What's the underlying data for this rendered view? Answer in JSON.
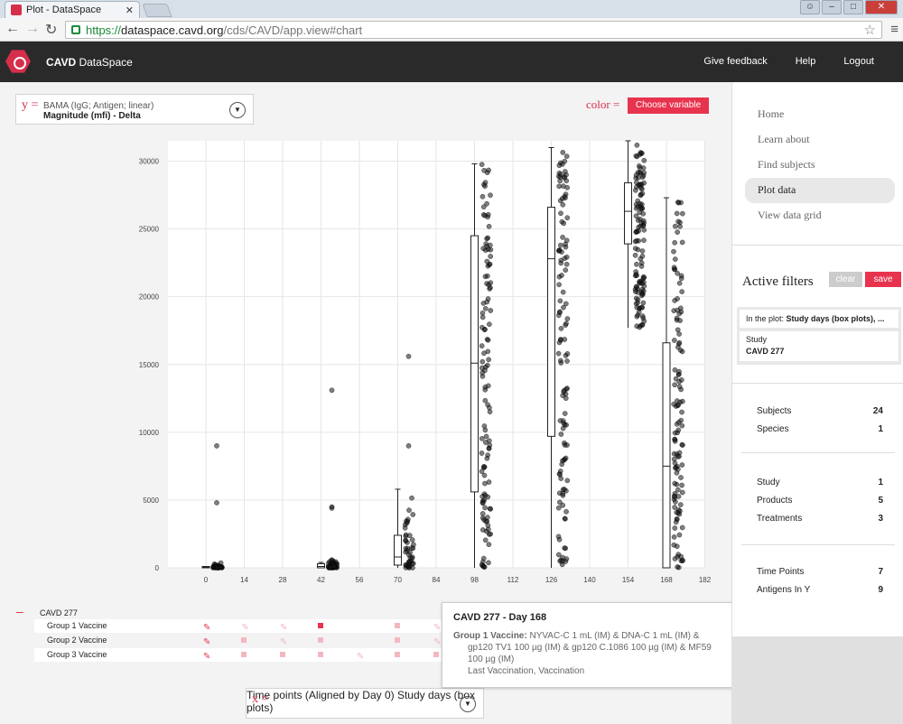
{
  "browser": {
    "tab_title": "Plot - DataSpace",
    "url_scheme": "https://",
    "url_host": "dataspace.cavd.org",
    "url_path": "/cds/CAVD/app.view#chart"
  },
  "app": {
    "name_bold": "CAVD",
    "name_rest": " DataSpace",
    "nav": [
      "Give feedback",
      "Help",
      "Logout"
    ]
  },
  "y_selector": {
    "letter": "y =",
    "line1": "BAMA (IgG; Antigen; linear)",
    "line2": "Magnitude (mfi) - Delta"
  },
  "color_selector": {
    "label": "color =",
    "button": "Choose variable"
  },
  "x_selector": {
    "letter": "x =",
    "line1": "Time points (Aligned by Day 0)",
    "line2": "Study days (box plots)"
  },
  "chart_data": {
    "type": "scatter",
    "xlabel": "",
    "ylabel": "",
    "x_ticks": [
      0,
      14,
      28,
      42,
      56,
      70,
      84,
      98,
      112,
      126,
      140,
      154,
      168,
      182
    ],
    "y_ticks": [
      0,
      5000,
      10000,
      15000,
      20000,
      25000,
      30000
    ],
    "y_range": [
      0,
      31500
    ],
    "boxes": [
      {
        "day": 0,
        "q1": 0,
        "median": 50,
        "q3": 100,
        "min": 0,
        "max": 100
      },
      {
        "day": 42,
        "q1": 0,
        "median": 100,
        "q3": 300,
        "min": 0,
        "max": 400
      },
      {
        "day": 70,
        "q1": 200,
        "median": 800,
        "q3": 2400,
        "min": 0,
        "max": 5800
      },
      {
        "day": 98,
        "q1": 5600,
        "median": 15100,
        "q3": 24500,
        "min": 0,
        "max": 29800
      },
      {
        "day": 126,
        "q1": 9700,
        "median": 22800,
        "q3": 26600,
        "min": 0,
        "max": 31000
      },
      {
        "day": 154,
        "q1": 23900,
        "median": 26300,
        "q3": 28400,
        "min": 17700,
        "max": 31500
      },
      {
        "day": 168,
        "q1": 0,
        "median": 7500,
        "q3": 16600,
        "min": 0,
        "max": 27300
      }
    ],
    "outliers": [
      {
        "day": 0,
        "values": [
          9000,
          4800
        ]
      },
      {
        "day": 42,
        "values": [
          13100,
          4500,
          4400
        ]
      },
      {
        "day": 70,
        "values": [
          15600,
          9000
        ]
      }
    ]
  },
  "legend": {
    "study": "CAVD 277",
    "groups": [
      "Group 1 Vaccine",
      "Group 2 Vaccine",
      "Group 3 Vaccine"
    ]
  },
  "tooltip": {
    "title": "CAVD 277 - Day 168",
    "group_label": "Group 1 Vaccine:",
    "line1": " NYVAC-C 1 mL (IM) & DNA-C 1 mL (IM) &",
    "line2": "gp120 TV1 100 µg (IM) & gp120 C.1086 100 µg (IM) & MF59",
    "line3": "100 µg (IM)",
    "line4": "Last Vaccination, Vaccination"
  },
  "sidebar": {
    "nav": [
      "Home",
      "Learn about",
      "Find subjects",
      "Plot data",
      "View data grid"
    ],
    "active_filters_title": "Active filters",
    "clear": "clear",
    "save": "save",
    "filter1_label": "In the plot: ",
    "filter1_value": "Study days (box plots), ...",
    "filter2_label": "Study",
    "filter2_value": "CAVD 277",
    "stats": [
      {
        "label": "Subjects",
        "value": "24"
      },
      {
        "label": "Species",
        "value": "1"
      },
      {
        "label": "Study",
        "value": "1"
      },
      {
        "label": "Products",
        "value": "5"
      },
      {
        "label": "Treatments",
        "value": "3"
      },
      {
        "label": "Time Points",
        "value": "7"
      },
      {
        "label": "Antigens In Y",
        "value": "9"
      }
    ]
  }
}
